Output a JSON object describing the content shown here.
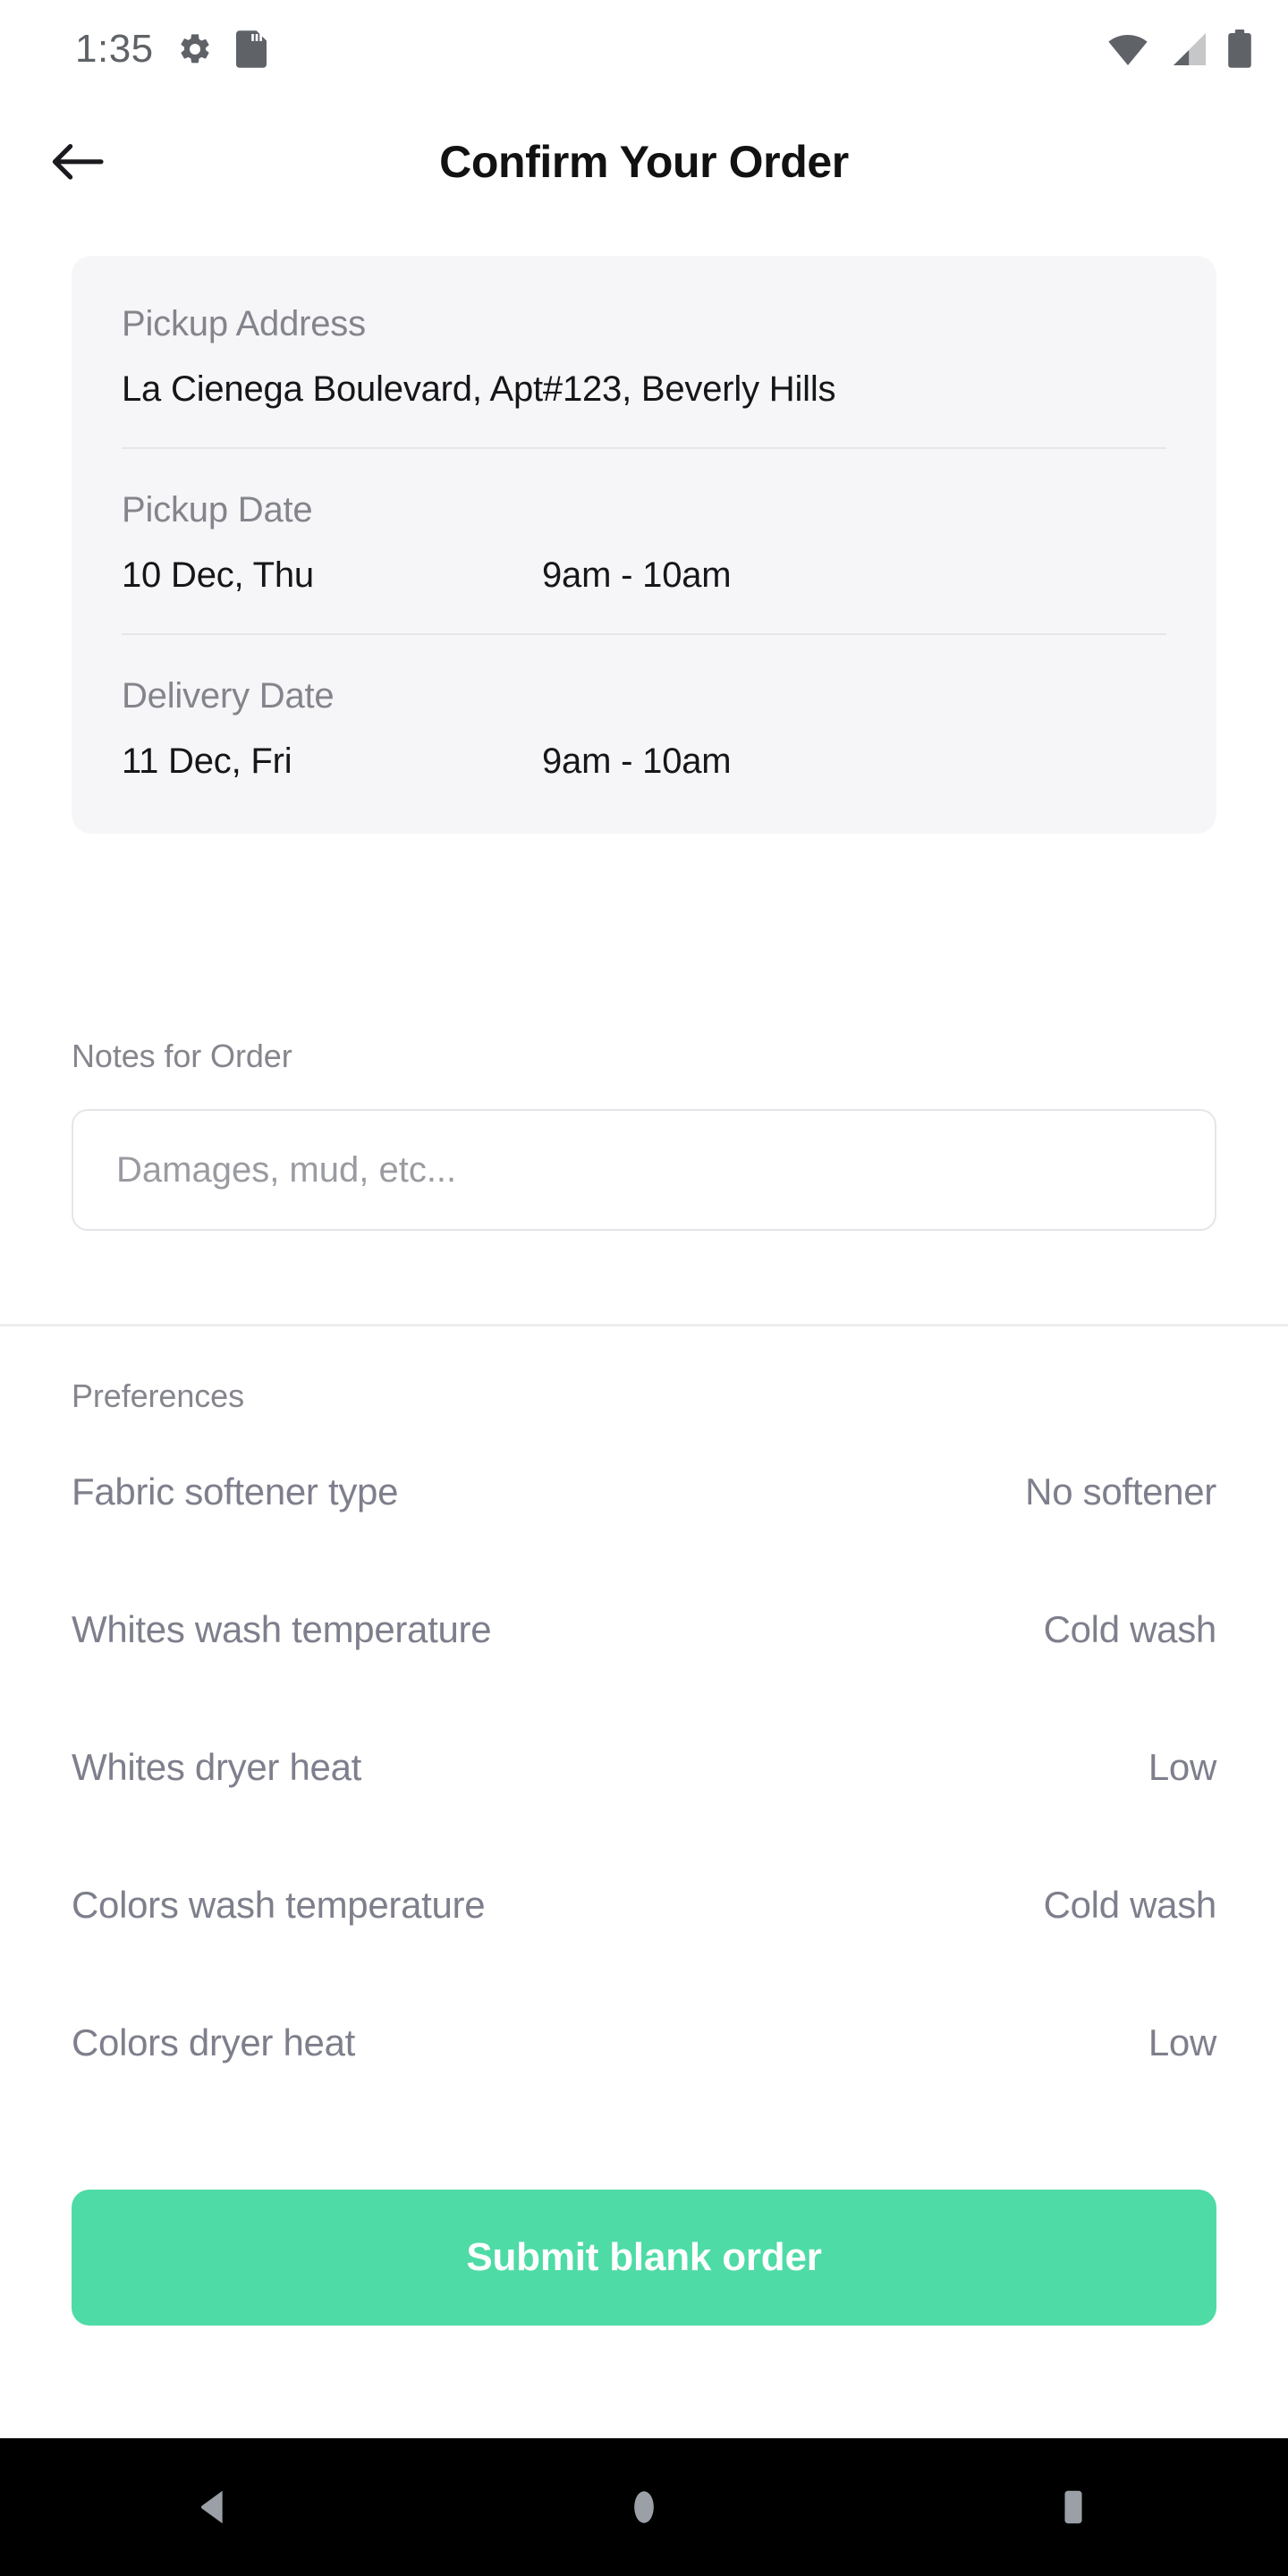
{
  "status_bar": {
    "time": "1:35",
    "icons": [
      "gear-icon",
      "sd-card-icon"
    ],
    "right_icons": [
      "wifi-icon",
      "cellular-signal-icon",
      "battery-icon"
    ]
  },
  "app_bar": {
    "back_icon": "back-arrow-icon",
    "title": "Confirm Your Order"
  },
  "summary_card": {
    "pickup_address": {
      "label": "Pickup Address",
      "value": "La Cienega Boulevard, Apt#123, Beverly Hills"
    },
    "pickup_date": {
      "label": "Pickup Date",
      "date": "10 Dec, Thu",
      "time": "9am - 10am"
    },
    "delivery_date": {
      "label": "Delivery Date",
      "date": "11 Dec, Fri",
      "time": "9am - 10am"
    }
  },
  "notes": {
    "label": "Notes for Order",
    "value": "",
    "placeholder": "Damages, mud, etc..."
  },
  "preferences": {
    "caption": "Preferences",
    "rows": [
      {
        "key": "Fabric softener type",
        "value": "No softener"
      },
      {
        "key": "Whites wash temperature",
        "value": "Cold wash"
      },
      {
        "key": "Whites dryer heat",
        "value": "Low"
      },
      {
        "key": "Colors wash temperature",
        "value": "Cold wash"
      },
      {
        "key": "Colors dryer heat",
        "value": "Low"
      }
    ]
  },
  "submit": {
    "label": "Submit blank order",
    "color": "#4EDBA6"
  },
  "nav_bar": {
    "back": "nav-back-icon",
    "home": "nav-home-icon",
    "recents": "nav-recents-icon"
  },
  "colors": {
    "card_bg": "#F6F6F8",
    "label_gray": "#84858C",
    "text_dark": "#15161A",
    "pref_gray": "#7E7F8C",
    "accent_green": "#4EDBA6"
  }
}
